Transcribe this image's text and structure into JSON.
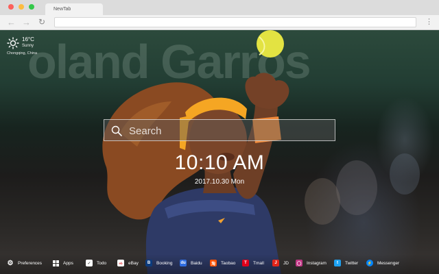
{
  "browser": {
    "tab_title": "NewTab"
  },
  "weather": {
    "temperature": "16°C",
    "condition": "Sunny",
    "location": "Chongqing, China"
  },
  "search": {
    "placeholder": "Search"
  },
  "clock": {
    "time": "10:10 AM",
    "date": "2017.10.30 Mon"
  },
  "wallpaper": {
    "banner_text": "oland Garros"
  },
  "bottom_links": [
    {
      "label": "Preferences",
      "icon": "gear-icon",
      "color": "#00000000"
    },
    {
      "label": "Apps",
      "icon": "grid-icon",
      "color": "#00000000"
    },
    {
      "label": "Todo",
      "icon": "checkbox-icon",
      "color": "#ffffff"
    },
    {
      "label": "eBay",
      "icon": "ebay-icon",
      "color": "#ffffff"
    },
    {
      "label": "Booking",
      "icon": "booking-icon",
      "color": "#0c3b7c"
    },
    {
      "label": "Baidu",
      "icon": "baidu-icon",
      "color": "#2f6de1"
    },
    {
      "label": "Taobao",
      "icon": "taobao-icon",
      "color": "#ff5000"
    },
    {
      "label": "Tmall",
      "icon": "tmall-icon",
      "color": "#e0001b"
    },
    {
      "label": "JD",
      "icon": "jd-icon",
      "color": "#e1251b"
    },
    {
      "label": "Instagram",
      "icon": "instagram-icon",
      "color": "#c13584"
    },
    {
      "label": "Twitter",
      "icon": "twitter-icon",
      "color": "#1da1f2"
    },
    {
      "label": "Messenger",
      "icon": "messenger-icon",
      "color": "#0084ff"
    }
  ]
}
